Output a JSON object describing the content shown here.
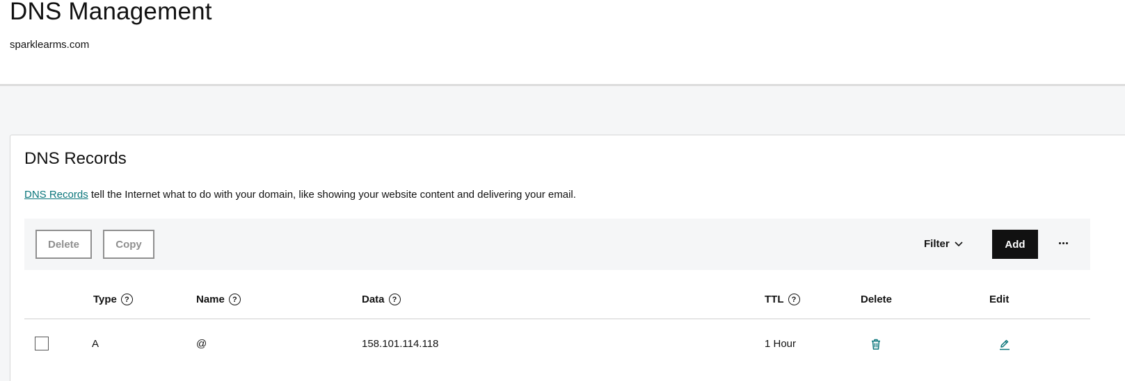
{
  "header": {
    "title": "DNS Management",
    "domain": "sparklearms.com"
  },
  "records_card": {
    "title": "DNS Records",
    "description_link": "DNS Records",
    "description_text": " tell the Internet what to do with your domain, like showing your website content and delivering your email."
  },
  "toolbar": {
    "delete_label": "Delete",
    "copy_label": "Copy",
    "filter_label": "Filter",
    "add_label": "Add"
  },
  "table": {
    "columns": {
      "type": "Type",
      "name": "Name",
      "data": "Data",
      "ttl": "TTL",
      "delete": "Delete",
      "edit": "Edit"
    },
    "help_glyph": "?",
    "rows": [
      {
        "type": "A",
        "name": "@",
        "data": "158.101.114.118",
        "ttl": "1 Hour"
      }
    ]
  },
  "icons": {
    "help": "help-circle-icon",
    "filter_chevron": "chevron-down-icon",
    "more": "more-horizontal-icon",
    "delete": "trash-icon",
    "edit": "pencil-icon"
  },
  "colors": {
    "accent": "#09757a",
    "primary_button": "#111111",
    "disabled_button": "#8f8f8f",
    "background": "#f5f6f7"
  }
}
